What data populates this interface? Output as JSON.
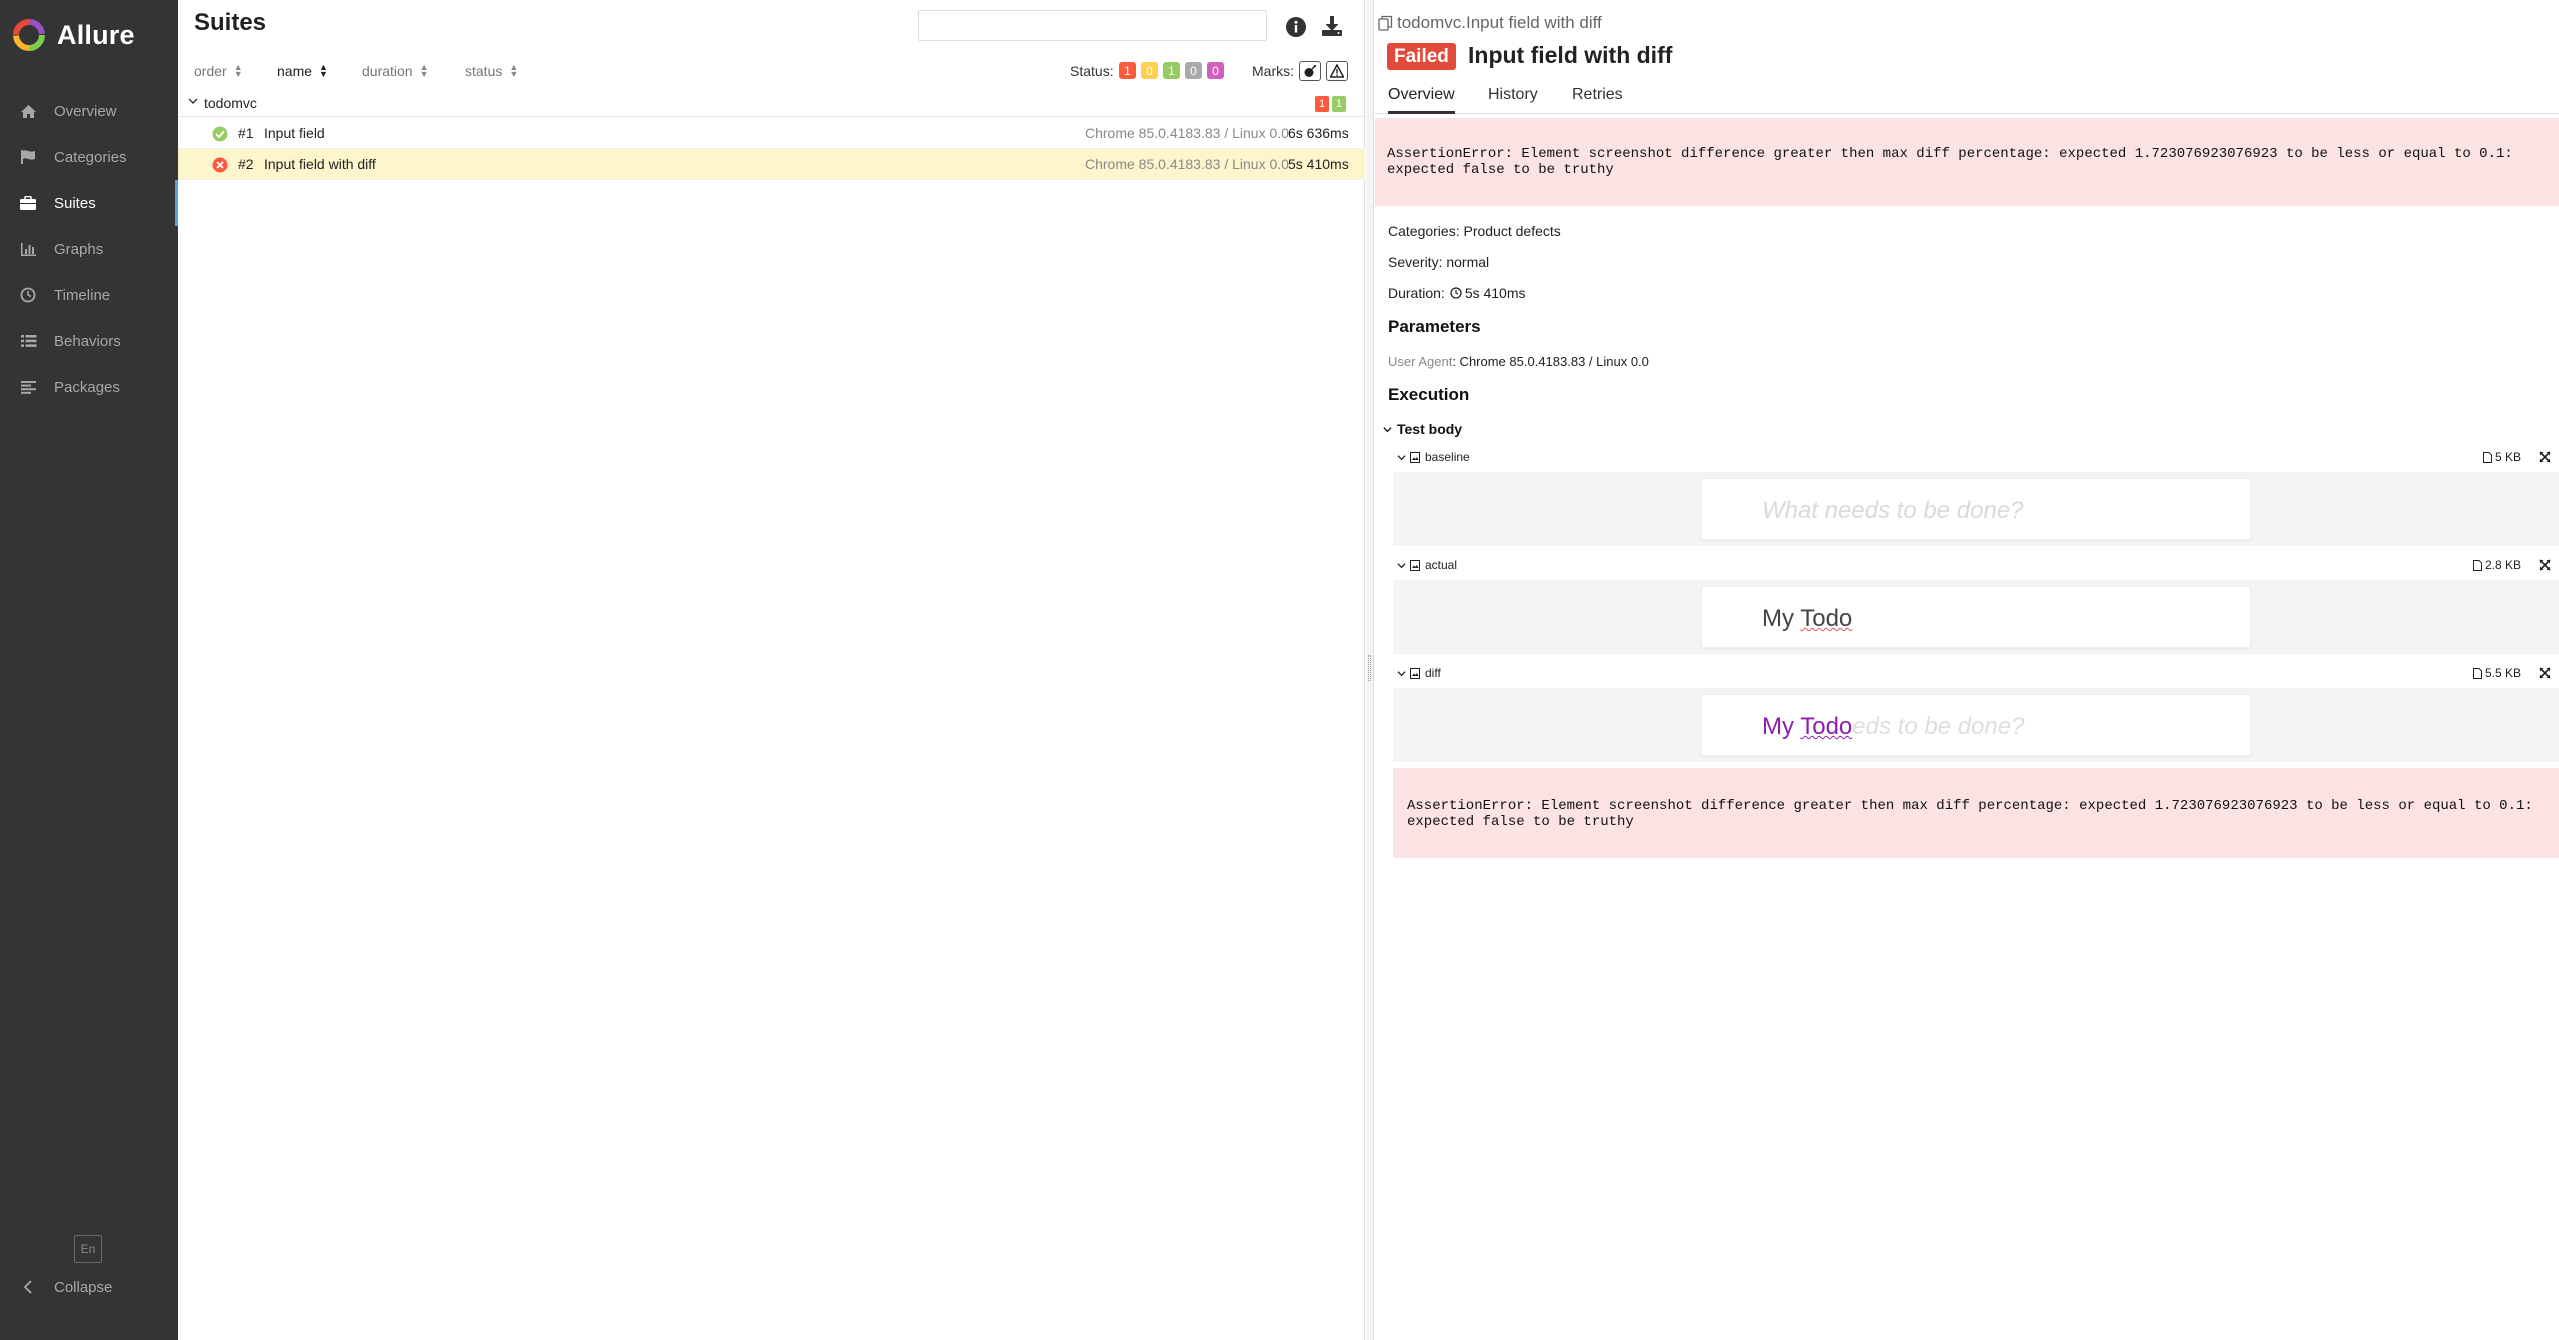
{
  "app": {
    "name": "Allure"
  },
  "sidebar": {
    "items": [
      {
        "label": "Overview",
        "icon": "home-icon"
      },
      {
        "label": "Categories",
        "icon": "flag-icon"
      },
      {
        "label": "Suites",
        "icon": "briefcase-icon"
      },
      {
        "label": "Graphs",
        "icon": "bar-chart-icon"
      },
      {
        "label": "Timeline",
        "icon": "clock-icon"
      },
      {
        "label": "Behaviors",
        "icon": "list-icon"
      },
      {
        "label": "Packages",
        "icon": "align-left-icon"
      }
    ],
    "active": "Suites",
    "language": "En",
    "collapse_label": "Collapse"
  },
  "suites": {
    "title": "Suites",
    "search": {
      "value": "",
      "placeholder": ""
    },
    "sort": {
      "order": "order",
      "name": "name",
      "duration": "duration",
      "status": "status"
    },
    "status_label": "Status:",
    "status_counts": [
      {
        "value": "1",
        "color": "#fd5a3e"
      },
      {
        "value": "0",
        "color": "#ffd050"
      },
      {
        "value": "1",
        "color": "#97cc64"
      },
      {
        "value": "0",
        "color": "#aaaaaa"
      },
      {
        "value": "0",
        "color": "#d35ebe"
      }
    ],
    "marks_label": "Marks:",
    "group": {
      "name": "todomvc",
      "badges": [
        {
          "value": "1",
          "color": "#fd5a3e"
        },
        {
          "value": "1",
          "color": "#97cc64"
        }
      ]
    },
    "tests": [
      {
        "num": "#1",
        "name": "Input field",
        "params": "Chrome 85.0.4183.83 / Linux 0.0",
        "duration": "6s 636ms",
        "status": "passed"
      },
      {
        "num": "#2",
        "name": "Input field with diff",
        "params": "Chrome 85.0.4183.83 / Linux 0.0",
        "duration": "5s 410ms",
        "status": "failed"
      }
    ]
  },
  "detail": {
    "breadcrumb": "todomvc.Input field with diff",
    "status": "Failed",
    "title": "Input field with diff",
    "tabs": [
      "Overview",
      "History",
      "Retries"
    ],
    "error_line1": "AssertionError: Element screenshot difference greater then max diff percentage: expected 1.723076923076923 to be less or equal to 0.1:",
    "error_line2": "expected false to be truthy",
    "categories": "Categories: Product defects",
    "severity": "Severity: normal",
    "duration_label": "Duration:",
    "duration_value": "5s 410ms",
    "parameters_title": "Parameters",
    "param_key": "User Agent",
    "param_value": ": Chrome 85.0.4183.83 / Linux 0.0",
    "execution_title": "Execution",
    "step_name": "Test body",
    "attachments": [
      {
        "name": "baseline",
        "size": "5 KB",
        "placeholder": "What needs to be done?"
      },
      {
        "name": "actual",
        "size": "2.8 KB",
        "text_my": "My",
        "text_todo": "Todo"
      },
      {
        "name": "diff",
        "size": "5.5 KB",
        "text_my": "My",
        "text_todo": "Todo",
        "ghost": "eds to be done?"
      }
    ],
    "step_error_line1": "AssertionError: Element screenshot difference greater then max diff percentage: expected 1.723076923076923 to be less or equal to 0.1:",
    "step_error_line2": "expected false to be truthy"
  },
  "colors": {
    "sidebar_bg": "#343434",
    "failed": "#e04b3a",
    "selected_row": "#fdf6cc",
    "error_bg": "#fbe3e3"
  }
}
